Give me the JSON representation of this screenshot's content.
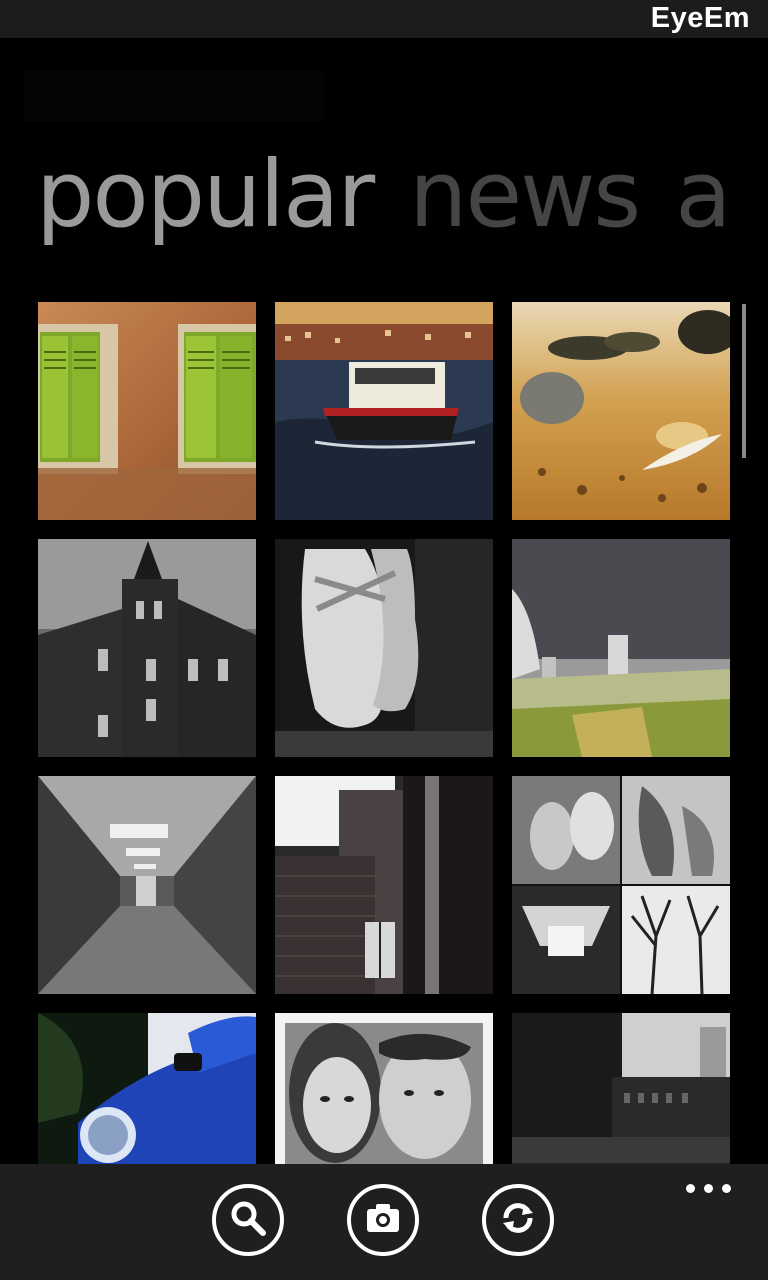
{
  "app": {
    "title": "EyeEm"
  },
  "pivot": {
    "items": [
      {
        "label": "popular",
        "active": true
      },
      {
        "label": "news",
        "active": false
      },
      {
        "label": "a",
        "active": false
      }
    ]
  },
  "grid": {
    "photos": [
      {
        "name": "photo-green-shutters"
      },
      {
        "name": "photo-ferry-boat"
      },
      {
        "name": "photo-sand-feather"
      },
      {
        "name": "photo-dark-house"
      },
      {
        "name": "photo-ballet-shoes"
      },
      {
        "name": "photo-inverted-landscape"
      },
      {
        "name": "photo-corridor"
      },
      {
        "name": "photo-brick-building"
      },
      {
        "name": "photo-collage"
      },
      {
        "name": "photo-blue-car"
      },
      {
        "name": "photo-couple-portrait"
      },
      {
        "name": "photo-industrial"
      }
    ]
  },
  "app_bar": {
    "buttons": [
      {
        "icon": "search-icon"
      },
      {
        "icon": "camera-icon"
      },
      {
        "icon": "refresh-icon"
      }
    ],
    "more_icon": "more-dots-icon"
  }
}
